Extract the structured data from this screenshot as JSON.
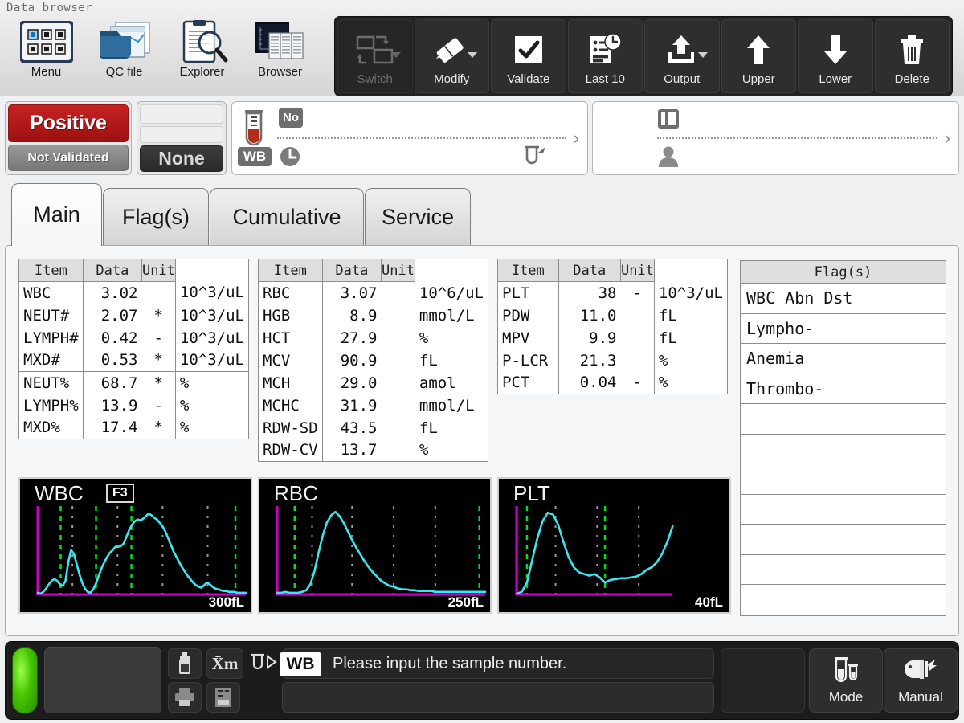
{
  "app": {
    "title": "Data browser"
  },
  "toolbar": {
    "light_buttons": [
      {
        "label": "Menu",
        "icon": "menu-grid-icon"
      },
      {
        "label": "QC file",
        "icon": "qc-file-chart-icon"
      },
      {
        "label": "Explorer",
        "icon": "explorer-magnifier-icon"
      },
      {
        "label": "Browser",
        "icon": "browser-table-icon"
      }
    ],
    "dark_buttons": [
      {
        "label": "Switch",
        "icon": "switch-icon",
        "disabled": true,
        "has_caret": true
      },
      {
        "label": "Modify",
        "icon": "modify-eraser-icon",
        "disabled": false,
        "has_caret": true
      },
      {
        "label": "Validate",
        "icon": "validate-check-icon",
        "disabled": false,
        "has_caret": false
      },
      {
        "label": "Last 10",
        "icon": "last10-clock-icon",
        "disabled": false,
        "has_caret": false
      },
      {
        "label": "Output",
        "icon": "output-upload-icon",
        "disabled": false,
        "has_caret": true
      },
      {
        "label": "Upper",
        "icon": "arrow-up-icon",
        "disabled": false,
        "has_caret": false
      },
      {
        "label": "Lower",
        "icon": "arrow-down-icon",
        "disabled": false,
        "has_caret": false
      },
      {
        "label": "Delete",
        "icon": "trash-icon",
        "disabled": false,
        "has_caret": false
      }
    ]
  },
  "status": {
    "result_flag": "Positive",
    "validation_state": "Not Validated",
    "secondary_state": "None",
    "sample_panel": {
      "tube_icon": "blood-tube-icon",
      "mode_badge": "WB",
      "number_badge": "No",
      "time_icon": "clock-icon",
      "sample_icon": "sample-pipette-icon",
      "value": ""
    },
    "id_panel": {
      "id_icon": "id-card-icon",
      "patient_icon": "patient-person-icon",
      "value": ""
    }
  },
  "tabs": [
    {
      "label": "Main",
      "active": true
    },
    {
      "label": "Flag(s)",
      "active": false
    },
    {
      "label": "Cumulative",
      "active": false
    },
    {
      "label": "Service",
      "active": false
    }
  ],
  "tables": {
    "headers": [
      "Item",
      "Data",
      "Unit"
    ],
    "wbc": [
      {
        "item": "WBC",
        "value": "3.02",
        "mark": "",
        "unit": "10^3/uL",
        "group": 0
      },
      {
        "item": "NEUT#",
        "value": "2.07",
        "mark": "*",
        "unit": "10^3/uL",
        "group": 1
      },
      {
        "item": "LYMPH#",
        "value": "0.42",
        "mark": "-",
        "unit": "10^3/uL",
        "group": 1
      },
      {
        "item": "MXD#",
        "value": "0.53",
        "mark": "*",
        "unit": "10^3/uL",
        "group": 1
      },
      {
        "item": "NEUT%",
        "value": "68.7",
        "mark": "*",
        "unit": "%",
        "group": 2
      },
      {
        "item": "LYMPH%",
        "value": "13.9",
        "mark": "-",
        "unit": "%",
        "group": 2
      },
      {
        "item": "MXD%",
        "value": "17.4",
        "mark": "*",
        "unit": "%",
        "group": 2
      }
    ],
    "rbc": [
      {
        "item": "RBC",
        "value": "3.07",
        "mark": "",
        "unit": "10^6/uL"
      },
      {
        "item": "HGB",
        "value": "8.9",
        "mark": "",
        "unit": "mmol/L"
      },
      {
        "item": "HCT",
        "value": "27.9",
        "mark": "",
        "unit": "%"
      },
      {
        "item": "MCV",
        "value": "90.9",
        "mark": "",
        "unit": "fL"
      },
      {
        "item": "MCH",
        "value": "29.0",
        "mark": "",
        "unit": "amol"
      },
      {
        "item": "MCHC",
        "value": "31.9",
        "mark": "",
        "unit": "mmol/L"
      },
      {
        "item": "RDW-SD",
        "value": "43.5",
        "mark": "",
        "unit": "fL"
      },
      {
        "item": "RDW-CV",
        "value": "13.7",
        "mark": "",
        "unit": "%"
      }
    ],
    "plt": [
      {
        "item": "PLT",
        "value": "38",
        "mark": "-",
        "unit": "10^3/uL"
      },
      {
        "item": "PDW",
        "value": "11.0",
        "mark": "",
        "unit": "fL"
      },
      {
        "item": "MPV",
        "value": "9.9",
        "mark": "",
        "unit": "fL"
      },
      {
        "item": "P-LCR",
        "value": "21.3",
        "mark": "",
        "unit": "%"
      },
      {
        "item": "PCT",
        "value": "0.04",
        "mark": "-",
        "unit": "%"
      }
    ]
  },
  "flags": {
    "header": "Flag(s)",
    "rows": [
      "WBC Abn Dst",
      "Lympho-",
      "Anemia",
      "Thrombo-",
      "",
      "",
      "",
      "",
      "",
      "",
      "",
      ""
    ]
  },
  "chart_data": [
    {
      "type": "line",
      "title": "WBC",
      "badge": "F3",
      "xlabel": "",
      "ylabel": "",
      "axis_max_label": "300fL",
      "xlim": [
        0,
        300
      ],
      "ylim": [
        0,
        100
      ],
      "grid": true,
      "gridlines_x": [
        50,
        115,
        180,
        245
      ],
      "discriminators_x": [
        33,
        84,
        135,
        285
      ],
      "discriminator_color": "#00dd22",
      "curve_color": "#38e8f0",
      "axis_color": "#cc00cc",
      "background": "#000000",
      "x": [
        0,
        4,
        8,
        12,
        16,
        20,
        24,
        28,
        32,
        36,
        40,
        44,
        48,
        52,
        56,
        60,
        64,
        68,
        72,
        76,
        80,
        84,
        88,
        92,
        96,
        100,
        104,
        108,
        112,
        116,
        120,
        124,
        128,
        132,
        136,
        140,
        144,
        148,
        152,
        156,
        160,
        164,
        168,
        172,
        176,
        180,
        184,
        188,
        192,
        196,
        200,
        204,
        208,
        212,
        216,
        220,
        224,
        228,
        232,
        236,
        240,
        244,
        248,
        252,
        256,
        260,
        264,
        268,
        272,
        276,
        280,
        284,
        288,
        292,
        296,
        300
      ],
      "y": [
        2,
        1,
        3,
        7,
        12,
        16,
        18,
        16,
        12,
        10,
        16,
        38,
        52,
        48,
        36,
        24,
        14,
        7,
        3,
        2,
        6,
        13,
        22,
        31,
        38,
        44,
        49,
        52,
        56,
        56,
        57,
        60,
        68,
        76,
        82,
        86,
        88,
        87,
        89,
        92,
        95,
        93,
        90,
        88,
        84,
        80,
        74,
        66,
        58,
        50,
        44,
        38,
        32,
        27,
        22,
        18,
        14,
        11,
        9,
        8,
        11,
        14,
        12,
        9,
        7,
        6,
        5,
        4,
        4,
        3,
        3,
        3,
        2,
        2,
        2,
        2
      ]
    },
    {
      "type": "line",
      "title": "RBC",
      "badge": "",
      "xlabel": "",
      "ylabel": "",
      "axis_max_label": "250fL",
      "xlim": [
        0,
        250
      ],
      "ylim": [
        0,
        100
      ],
      "grid": true,
      "gridlines_x": [
        42,
        90,
        140,
        190
      ],
      "discriminators_x": [
        21,
        243
      ],
      "discriminator_color": "#00dd22",
      "curve_color": "#38e8f0",
      "axis_color": "#cc00cc",
      "background": "#000000",
      "x": [
        0,
        5,
        10,
        15,
        20,
        25,
        30,
        35,
        40,
        45,
        50,
        55,
        60,
        65,
        70,
        75,
        80,
        85,
        90,
        95,
        100,
        105,
        110,
        115,
        120,
        125,
        130,
        135,
        140,
        145,
        150,
        155,
        160,
        165,
        170,
        175,
        180,
        185,
        190,
        195,
        200,
        205,
        210,
        215,
        220,
        225,
        230,
        235,
        240,
        245,
        250
      ],
      "y": [
        2,
        2,
        3,
        2,
        2,
        2,
        3,
        5,
        12,
        28,
        50,
        70,
        85,
        93,
        97,
        92,
        84,
        74,
        64,
        55,
        47,
        39,
        32,
        26,
        21,
        16,
        13,
        10,
        9,
        7,
        6,
        6,
        5,
        5,
        4,
        4,
        4,
        4,
        3,
        3,
        3,
        3,
        3,
        3,
        3,
        3,
        3,
        3,
        3,
        3,
        3
      ]
    },
    {
      "type": "line",
      "title": "PLT",
      "badge": "",
      "xlabel": "",
      "ylabel": "",
      "axis_max_label": "40fL",
      "xlim": [
        0,
        40
      ],
      "ylim": [
        0,
        100
      ],
      "grid": true,
      "gridlines_x": [
        7.5,
        15.5,
        23.5
      ],
      "discriminators_x": [
        2.0,
        17.0
      ],
      "discriminator_color": "#00dd22",
      "curve_color": "#38e8f0",
      "axis_color": "#cc00cc",
      "background": "#000000",
      "x": [
        0,
        1,
        2,
        3,
        4,
        5,
        6,
        7,
        8,
        9,
        10,
        11,
        12,
        13,
        14,
        15,
        16,
        17,
        18,
        19,
        20,
        21,
        22,
        23,
        24,
        25,
        26,
        27,
        28,
        29,
        30
      ],
      "y": [
        1,
        3,
        14,
        40,
        66,
        86,
        96,
        94,
        82,
        62,
        44,
        32,
        26,
        24,
        22,
        24,
        20,
        14,
        17,
        18,
        19,
        19,
        20,
        21,
        24,
        29,
        32,
        38,
        48,
        62,
        80
      ]
    }
  ],
  "bottom": {
    "message": "Please input the sample number.",
    "mode_badge": "WB",
    "input_value": "",
    "icons": [
      {
        "name": "reagent-bottle-icon"
      },
      {
        "name": "xm-mean-icon"
      },
      {
        "name": "sample-aspirate-icon"
      },
      {
        "name": "printer-icon"
      },
      {
        "name": "host-computer-icon"
      }
    ],
    "buttons": [
      {
        "label": "Mode",
        "icon": "tubes-mode-icon"
      },
      {
        "label": "Manual",
        "icon": "manual-hand-icon"
      }
    ]
  },
  "colors": {
    "positive_red": "#9d1111",
    "led_green": "#46c400",
    "curve_cyan": "#38e8f0",
    "axis_magenta": "#cc00cc",
    "discriminator_green": "#00dd22"
  }
}
